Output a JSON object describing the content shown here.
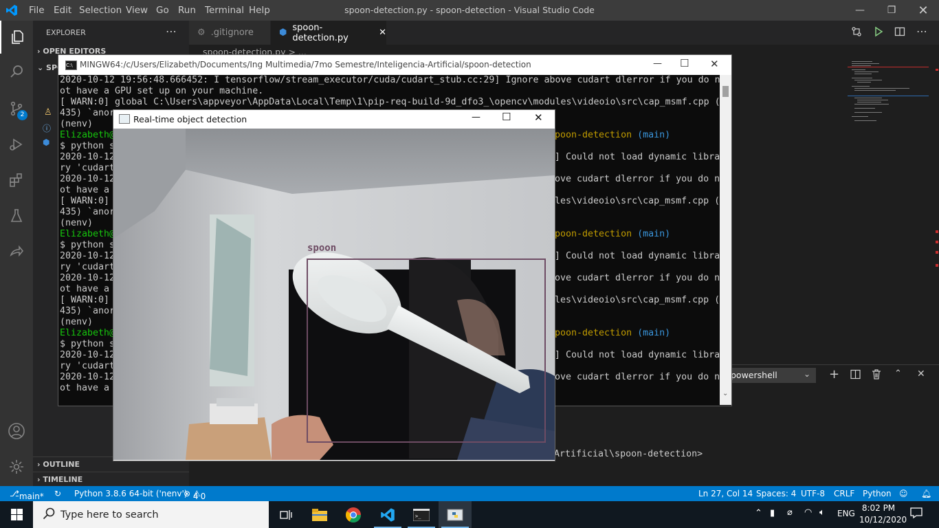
{
  "window": {
    "title": "spoon-detection.py - spoon-detection - Visual Studio Code",
    "menu": [
      "File",
      "Edit",
      "Selection",
      "View",
      "Go",
      "Run",
      "Terminal",
      "Help"
    ]
  },
  "tabs": [
    {
      "label": ".gitignore",
      "active": false
    },
    {
      "label": "spoon-detection.py",
      "active": true
    }
  ],
  "breadcrumb": "spoon-detection.py > ...",
  "sidebar": {
    "header": "EXPLORER",
    "open_editors": "OPEN EDITORS",
    "folder": "SPC",
    "outline": "OUTLINE",
    "timeline": "TIMELINE"
  },
  "activity": {
    "scm_badge": "2"
  },
  "mingw": {
    "title": "MINGW64:/c/Users/Elizabeth/Documents/Ing Multimedia/7mo Semestre/Inteligencia-Artificial/spoon-detection",
    "lines": [
      "2020-10-12 19:56:48.666452: I tensorflow/stream_executor/cuda/cudart_stub.cc:29] Ignore above cudart dlerror if you do n",
      "ot have a GPU set up on your machine.",
      "[ WARN:0] global C:\\Users\\appveyor\\AppData\\Local\\Temp\\1\\pip-req-build-9d_dfo3_\\opencv\\modules\\videoio\\src\\cap_msmf.cpp (",
      "435) `anor",
      "(nenv)",
      "Elizabeth@",
      "$ python s",
      "2020-10-12",
      "ry 'cudart",
      "2020-10-12",
      "ot have a",
      "[ WARN:0]",
      "435) `anor",
      "(nenv)",
      "Elizabeth@",
      "$ python s",
      "2020-10-12",
      "ry 'cudart",
      "2020-10-12",
      "ot have a",
      "[ WARN:0]",
      "435) `anor",
      "(nenv)",
      "Elizabeth@",
      "$ python s",
      "2020-10-12",
      "ry 'cudart",
      "2020-10-12",
      "ot have a"
    ],
    "right_fragments": [
      {
        "line": 5,
        "text": "poon-detection",
        "branch": "(main)"
      },
      {
        "line": 7,
        "text": "] Could not load dynamic libra"
      },
      {
        "line": 9,
        "text": "ove cudart dlerror if you do n"
      },
      {
        "line": 11,
        "text": "les\\videoio\\src\\cap_msmf.cpp ("
      },
      {
        "line": 14,
        "text": "poon-detection",
        "branch": "(main)"
      },
      {
        "line": 16,
        "text": "] Could not load dynamic libra"
      },
      {
        "line": 18,
        "text": "ove cudart dlerror if you do n"
      },
      {
        "line": 20,
        "text": "les\\videoio\\src\\cap_msmf.cpp ("
      },
      {
        "line": 23,
        "text": "poon-detection",
        "branch": "(main)"
      },
      {
        "line": 25,
        "text": "] Could not load dynamic libra"
      },
      {
        "line": 27,
        "text": "ove cudart dlerror if you do n"
      }
    ]
  },
  "detection_window": {
    "title": "Real-time object detection",
    "label": "spoon"
  },
  "panel": {
    "shell": "powershell",
    "prompt_tail": "Artificial\\spoon-detection>"
  },
  "statusbar": {
    "branch": "main*",
    "python": "Python 3.8.6 64-bit ('nenv')",
    "errors": "4",
    "warnings": "0",
    "position": "Ln 27, Col 14",
    "spaces": "Spaces: 4",
    "encoding": "UTF-8",
    "eol": "CRLF",
    "language": "Python"
  },
  "taskbar": {
    "search_placeholder": "Type here to search",
    "lang": "ENG",
    "time": "8:02 PM",
    "date": "10/12/2020"
  }
}
